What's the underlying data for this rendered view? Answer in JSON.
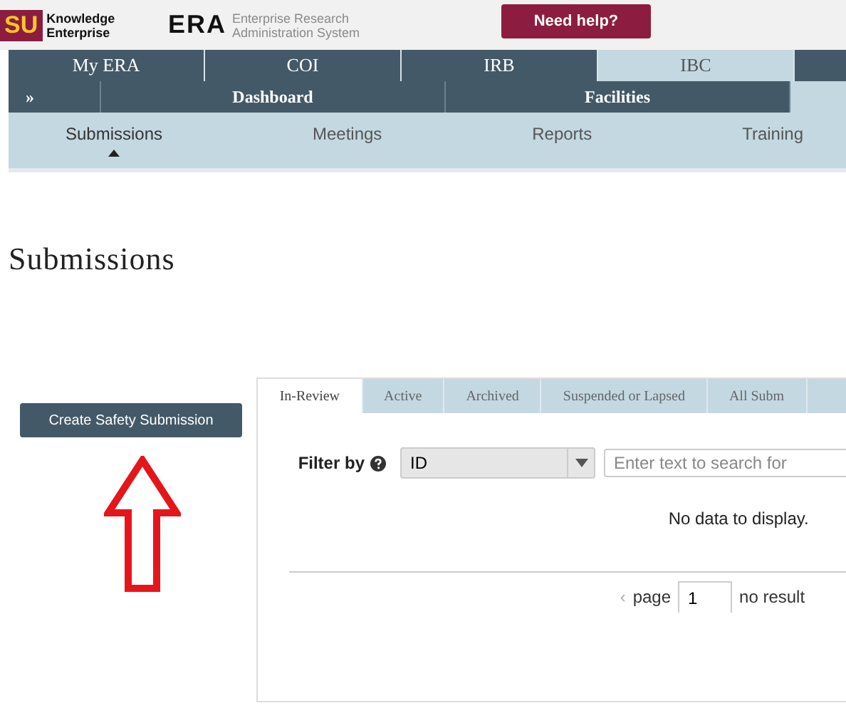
{
  "header": {
    "logo_text": "SU",
    "logo_subtitle": "Knowledge Enterprise",
    "era_logo": "ERA",
    "era_subtitle_1": "Enterprise Research",
    "era_subtitle_2": "Administration System",
    "help_button": "Need help?"
  },
  "top_tabs": [
    {
      "label": "My ERA",
      "selected": false
    },
    {
      "label": "COI",
      "selected": false
    },
    {
      "label": "IRB",
      "selected": false
    },
    {
      "label": "IBC",
      "selected": true
    }
  ],
  "sub_nav": {
    "toggle": "»",
    "items": [
      "Dashboard",
      "Facilities"
    ]
  },
  "section_nav": [
    {
      "label": "Submissions",
      "selected": true
    },
    {
      "label": "Meetings",
      "selected": false
    },
    {
      "label": "Reports",
      "selected": false
    },
    {
      "label": "Training",
      "selected": false
    }
  ],
  "page_title": "Submissions",
  "create_button": "Create Safety Submission",
  "panel": {
    "tabs": [
      {
        "label": "In-Review",
        "selected": true
      },
      {
        "label": "Active",
        "selected": false
      },
      {
        "label": "Archived",
        "selected": false
      },
      {
        "label": "Suspended or Lapsed",
        "selected": false
      },
      {
        "label": "All Subm",
        "selected": false
      }
    ],
    "filter_label": "Filter by",
    "filter_select": "ID",
    "search_placeholder": "Enter text to search for",
    "empty_message": "No data to display.",
    "pager_prev": "‹",
    "pager_label": "page",
    "pager_value": "1",
    "pager_result": "no result"
  }
}
